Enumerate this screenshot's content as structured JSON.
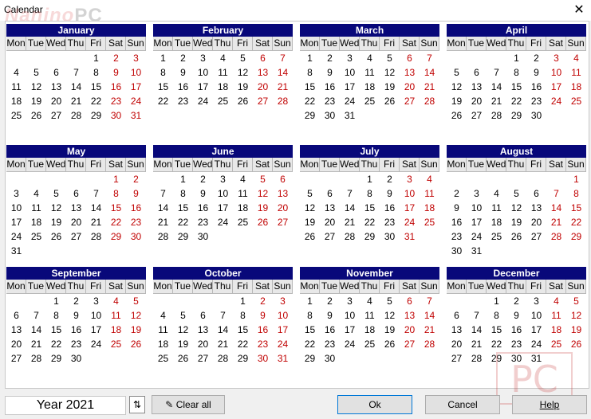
{
  "window": {
    "title": "Calendar",
    "close_glyph": "✕",
    "icon": "close-icon"
  },
  "watermark": {
    "main": "Nanino",
    "accent": "PC"
  },
  "weekdays": [
    "Mon",
    "Tue",
    "Wed",
    "Thu",
    "Fri",
    "Sat",
    "Sun"
  ],
  "months": [
    {
      "name": "January",
      "start": 4,
      "days": 31
    },
    {
      "name": "February",
      "start": 0,
      "days": 28
    },
    {
      "name": "March",
      "start": 0,
      "days": 31
    },
    {
      "name": "April",
      "start": 3,
      "days": 30
    },
    {
      "name": "May",
      "start": 5,
      "days": 31
    },
    {
      "name": "June",
      "start": 1,
      "days": 30
    },
    {
      "name": "July",
      "start": 3,
      "days": 31
    },
    {
      "name": "August",
      "start": 6,
      "days": 31
    },
    {
      "name": "September",
      "start": 2,
      "days": 30
    },
    {
      "name": "October",
      "start": 4,
      "days": 31
    },
    {
      "name": "November",
      "start": 0,
      "days": 30
    },
    {
      "name": "December",
      "start": 2,
      "days": 31
    }
  ],
  "colors": {
    "header_bg": "#08087a",
    "weekend": "#c00000"
  },
  "footer": {
    "year_text": "Year 2021",
    "spin_icon": "spin-arrows-icon",
    "clear_icon": "eraser-icon",
    "clear_label": "Clear all",
    "ok_label": "Ok",
    "cancel_label": "Cancel",
    "help_label": "Help"
  },
  "logo_text": "PC"
}
